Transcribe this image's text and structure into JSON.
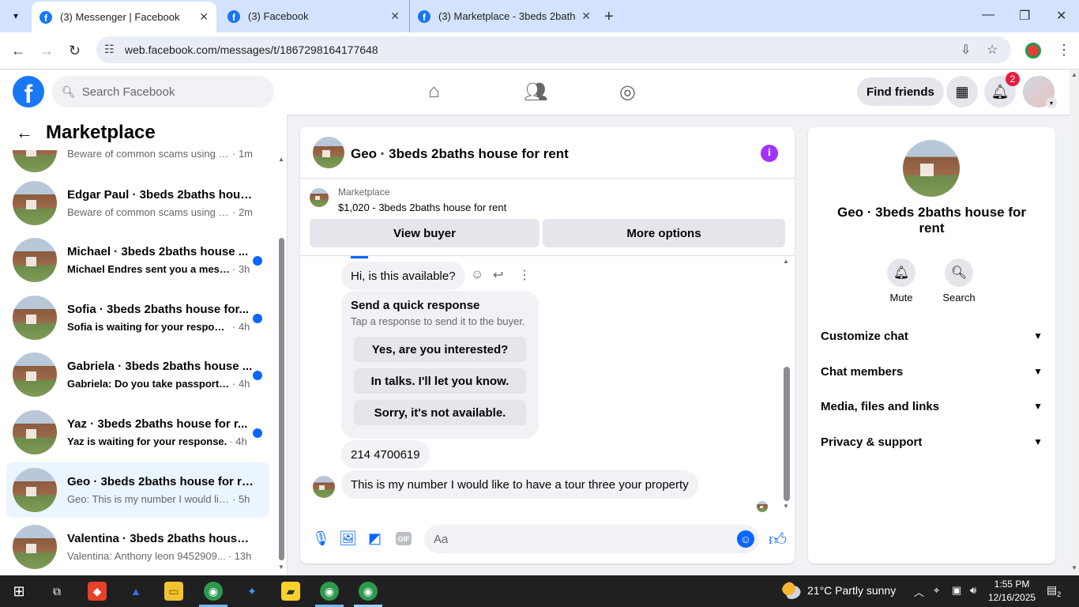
{
  "browser": {
    "tabs": [
      {
        "title": "(3) Messenger | Facebook",
        "active": true
      },
      {
        "title": "(3) Facebook",
        "active": false
      },
      {
        "title": "(3) Marketplace - 3beds 2baths",
        "active": false
      }
    ],
    "url": "web.facebook.com/messages/t/1867298164177648"
  },
  "fb_header": {
    "search_placeholder": "Search Facebook",
    "find_friends": "Find friends",
    "notification_count": "2"
  },
  "sidebar": {
    "title": "Marketplace",
    "conversations": [
      {
        "name": "",
        "snippet": "Beware of common scams using p...",
        "time": "· 1m",
        "unread": false,
        "selected": false
      },
      {
        "name": "Edgar Paul · 3beds 2baths house...",
        "snippet": "Beware of common scams using p...",
        "time": "· 2m",
        "unread": false,
        "selected": false
      },
      {
        "name": "Michael · 3beds 2baths house ...",
        "snippet": "Michael Endres sent you a mess...",
        "time": "· 3h",
        "unread": true,
        "selected": false
      },
      {
        "name": "Sofia · 3beds 2baths house for...",
        "snippet": "Sofia is waiting for your response.",
        "time": "· 4h",
        "unread": true,
        "selected": false
      },
      {
        "name": "Gabriela · 3beds 2baths house ...",
        "snippet": "Gabriela: Do you take passport f...",
        "time": "· 4h",
        "unread": true,
        "selected": false
      },
      {
        "name": "Yaz · 3beds 2baths house for r...",
        "snippet": "Yaz is waiting for your response.",
        "time": "· 4h",
        "unread": true,
        "selected": false
      },
      {
        "name": "Geo · 3beds 2baths house for rent",
        "snippet": "Geo: This is my number I would like...",
        "time": "· 5h",
        "unread": false,
        "selected": true
      },
      {
        "name": "Valentina · 3beds 2baths house f...",
        "snippet": "Valentina: Anthony leon 9452909...",
        "time": "· 13h",
        "unread": false,
        "selected": false
      }
    ]
  },
  "chat": {
    "title": "Geo · 3beds 2baths house for rent",
    "marketplace_label": "Marketplace",
    "listing": "$1,020 - 3beds 2baths house for rent",
    "view_buyer": "View buyer",
    "more_options": "More options",
    "msg_available": "Hi, is this available?",
    "quick_title": "Send a quick response",
    "quick_sub": "Tap a response to send it to the buyer.",
    "quick_options": [
      "Yes, are you interested?",
      "In talks. I'll let you know.",
      "Sorry, it's not available."
    ],
    "msg_number": "214 4700619",
    "msg_tour": "This is my number I would like to have a tour three your property",
    "composer_placeholder": "Aa"
  },
  "info_panel": {
    "title": "Geo · 3beds 2baths house for rent",
    "mute": "Mute",
    "search": "Search",
    "rows": [
      "Customize chat",
      "Chat members",
      "Media, files and links",
      "Privacy & support"
    ]
  },
  "taskbar": {
    "weather": "21°C  Partly sunny",
    "time": "1:55 PM",
    "date": "12/16/2025",
    "notifications": "2"
  },
  "colors": {
    "facebook_blue": "#1877f2",
    "messenger_blue": "#0866ff",
    "info_purple": "#a033ff",
    "badge_red": "#e41e3f"
  }
}
